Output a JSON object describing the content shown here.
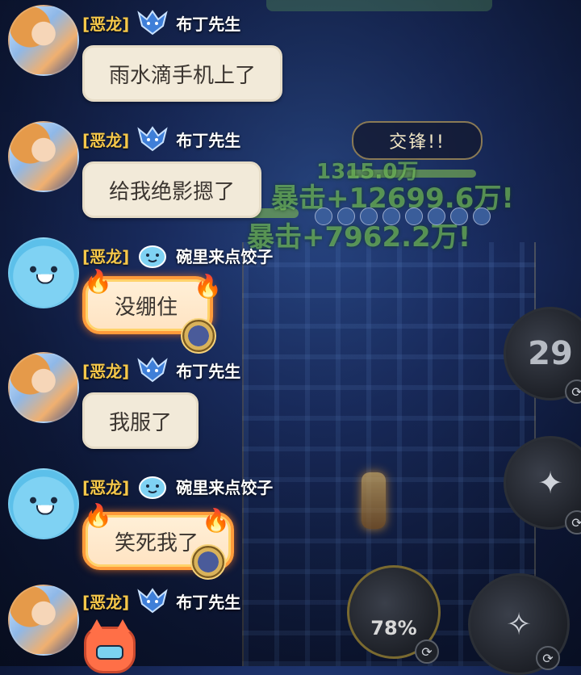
{
  "game": {
    "clash_label": "交锋!!",
    "float_texts": [
      "1315.0万",
      "暴击+12699.6万!",
      "暴击+7962.2万!"
    ],
    "skill_cooldown": "29",
    "energy_percent": "78%"
  },
  "chat": {
    "messages": [
      {
        "tag": "[恶龙]",
        "user": "布丁先生",
        "text": "雨水滴手机上了"
      },
      {
        "tag": "[恶龙]",
        "user": "布丁先生",
        "text": "给我绝影摁了"
      },
      {
        "tag": "[恶龙]",
        "user": "碗里来点饺子",
        "text": "没绷住"
      },
      {
        "tag": "[恶龙]",
        "user": "布丁先生",
        "text": "我服了"
      },
      {
        "tag": "[恶龙]",
        "user": "碗里来点饺子",
        "text": "笑死我了"
      },
      {
        "tag": "[恶龙]",
        "user": "布丁先生",
        "text": ""
      }
    ]
  },
  "icons": {
    "dragon_badge": "blue-dragon-badge-icon",
    "blob_badge": "blue-blob-badge-icon",
    "cat_sticker": "red-cat-sticker-icon"
  },
  "colors": {
    "tag": "#f6c84a",
    "bubble": "#f2ead9",
    "fire_border": "#ff9b3a"
  }
}
